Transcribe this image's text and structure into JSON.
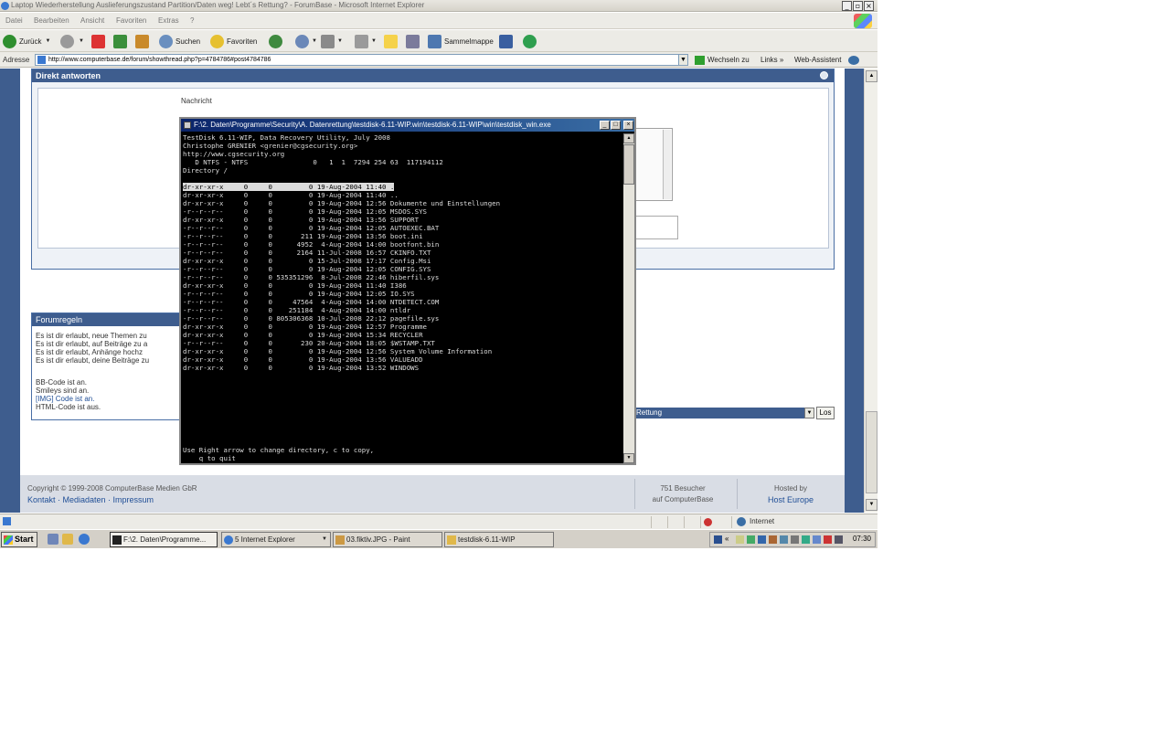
{
  "ie": {
    "title": "Laptop Wiederherstellung Auslieferungszustand Partition/Daten weg! Lebt´s Rettung? - ForumBase - Microsoft Internet Explorer",
    "menu": [
      "Datei",
      "Bearbeiten",
      "Ansicht",
      "Favoriten",
      "Extras",
      "?"
    ],
    "toolbar": {
      "back": "Zurück",
      "search": "Suchen",
      "favorites": "Favoriten",
      "collection": "Sammelmappe"
    },
    "address": {
      "label": "Adresse",
      "url": "http://www.computerbase.de/forum/showthread.php?p=4784786#post4784786",
      "go_label": "Wechseln zu",
      "links": "Links",
      "links_more": "»",
      "assistant": "Web-Assistent"
    }
  },
  "page": {
    "reply_title": "Direkt antworten",
    "nachricht_label": "Nachricht",
    "rules_title": "Forumregeln",
    "rules_lines": [
      "Es ist dir erlaubt, neue Themen zu",
      "Es ist dir erlaubt, auf Beiträge zu a",
      "Es ist dir erlaubt, Anhänge hochz",
      "Es ist dir erlaubt, deine Beiträge zu"
    ],
    "code_lines": [
      "BB-Code ist an.",
      "Smileys sind an.",
      "[IMG] Code ist an.",
      "HTML-Code ist aus."
    ],
    "jump_value": "Rettung",
    "go_button": "Los",
    "footer": {
      "copyright": "Copyright © 1999-2008 ComputerBase Medien GbR",
      "links": "Kontakt · Mediadaten · Impressum",
      "visitors_line1": "751 Besucher",
      "visitors_line2": "auf ComputerBase",
      "hosted_by": "Hosted by",
      "host": "Host Europe"
    }
  },
  "console": {
    "title": "F:\\2. Daten\\Programme\\Security\\A. Datenrettung\\testdisk-6.11-WIP.win\\testdisk-6.11-WIP\\win\\testdisk_win.exe",
    "header": [
      "TestDisk 6.11-WIP, Data Recovery Utility, July 2008",
      "Christophe GRENIER <grenier@cgsecurity.org>",
      "http://www.cgsecurity.org",
      "   D NTFS - NTFS                0   1  1  7294 254 63  117194112",
      "Directory /"
    ],
    "entries": [
      "dr-xr-xr-x     0     0         0 19-Aug-2004 11:40 .",
      "dr-xr-xr-x     0     0         0 19-Aug-2004 11:40 ..",
      "dr-xr-xr-x     0     0         0 19-Aug-2004 12:56 Dokumente und Einstellungen",
      "-r--r--r--     0     0         0 19-Aug-2004 12:05 MSDOS.SYS",
      "dr-xr-xr-x     0     0         0 19-Aug-2004 13:56 SUPPORT",
      "-r--r--r--     0     0         0 19-Aug-2004 12:05 AUTOEXEC.BAT",
      "-r--r--r--     0     0       211 19-Aug-2004 13:56 boot.ini",
      "-r--r--r--     0     0      4952  4-Aug-2004 14:00 bootfont.bin",
      "-r--r--r--     0     0      2164 11-Jul-2008 16:57 CKINFO.TXT",
      "dr-xr-xr-x     0     0         0 15-Jul-2008 17:17 Config.Msi",
      "-r--r--r--     0     0         0 19-Aug-2004 12:05 CONFIG.SYS",
      "-r--r--r--     0     0 535351296  8-Jul-2008 22:46 hiberfil.sys",
      "dr-xr-xr-x     0     0         0 19-Aug-2004 11:40 I386",
      "-r--r--r--     0     0         0 19-Aug-2004 12:05 IO.SYS",
      "-r--r--r--     0     0     47564  4-Aug-2004 14:00 NTDETECT.COM",
      "-r--r--r--     0     0    251184  4-Aug-2004 14:00 ntldr",
      "-r--r--r--     0     0 805306368 10-Jul-2008 22:12 pagefile.sys",
      "dr-xr-xr-x     0     0         0 19-Aug-2004 12:57 Programme",
      "dr-xr-xr-x     0     0         0 19-Aug-2004 15:34 RECYCLER",
      "-r--r--r--     0     0       230 20-Aug-2004 18:05 $WSTAMP.TXT",
      "dr-xr-xr-x     0     0         0 19-Aug-2004 12:56 System Volume Information",
      "dr-xr-xr-x     0     0         0 19-Aug-2004 13:56 VALUEADD",
      "dr-xr-xr-x     0     0         0 19-Aug-2004 13:52 WINDOWS"
    ],
    "footer1": "Use Right arrow to change directory, c to copy,",
    "footer2": "    q to quit"
  },
  "status": {
    "zone": "Internet"
  },
  "taskbar": {
    "start": "Start",
    "tasks": [
      "F:\\2. Daten\\Programme...",
      "5 Internet Explorer",
      "03.fiktiv.JPG - Paint",
      "testdisk-6.11-WIP"
    ],
    "clock": "07:30"
  }
}
